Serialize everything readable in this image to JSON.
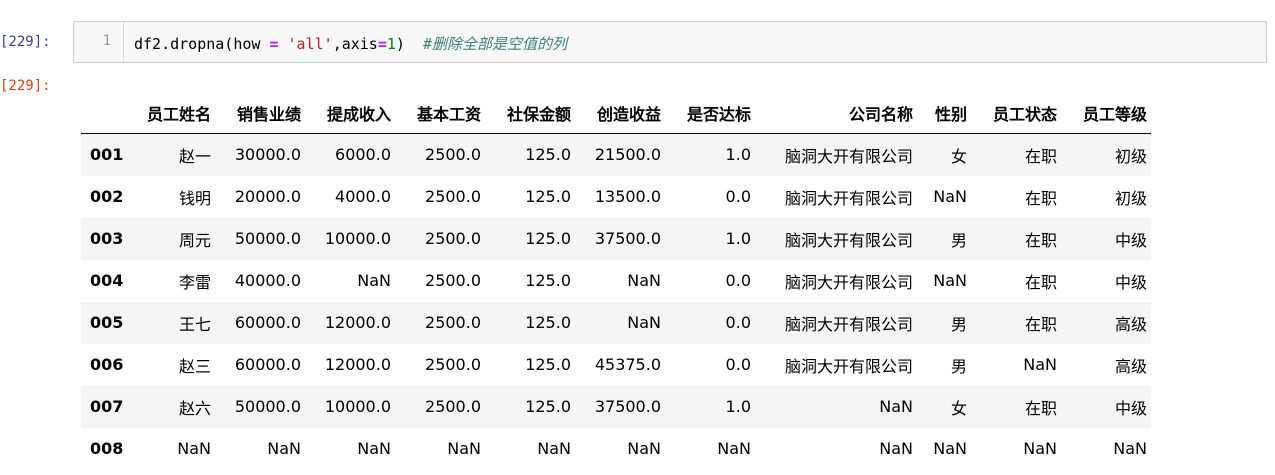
{
  "input_cell": {
    "prompt": "[229]:",
    "line_number": "1",
    "code": {
      "part1": "df2.dropna(how",
      "eq1": "=",
      "str": "'all'",
      "comma_axis": ",axis",
      "eq2": "=",
      "num": "1",
      "close": ")",
      "comment": "#删除全部是空值的列"
    }
  },
  "output_cell": {
    "prompt": "[229]:",
    "table": {
      "columns": [
        "员工姓名",
        "销售业绩",
        "提成收入",
        "基本工资",
        "社保金额",
        "创造收益",
        "是否达标",
        "公司名称",
        "性别",
        "员工状态",
        "员工等级"
      ],
      "rows": [
        {
          "index": "001",
          "cells": [
            "赵一",
            "30000.0",
            "6000.0",
            "2500.0",
            "125.0",
            "21500.0",
            "1.0",
            "脑洞大开有限公司",
            "女",
            "在职",
            "初级"
          ]
        },
        {
          "index": "002",
          "cells": [
            "钱明",
            "20000.0",
            "4000.0",
            "2500.0",
            "125.0",
            "13500.0",
            "0.0",
            "脑洞大开有限公司",
            "NaN",
            "在职",
            "初级"
          ]
        },
        {
          "index": "003",
          "cells": [
            "周元",
            "50000.0",
            "10000.0",
            "2500.0",
            "125.0",
            "37500.0",
            "1.0",
            "脑洞大开有限公司",
            "男",
            "在职",
            "中级"
          ]
        },
        {
          "index": "004",
          "cells": [
            "李雷",
            "40000.0",
            "NaN",
            "2500.0",
            "125.0",
            "NaN",
            "0.0",
            "脑洞大开有限公司",
            "NaN",
            "在职",
            "中级"
          ]
        },
        {
          "index": "005",
          "cells": [
            "王七",
            "60000.0",
            "12000.0",
            "2500.0",
            "125.0",
            "NaN",
            "0.0",
            "脑洞大开有限公司",
            "男",
            "在职",
            "高级"
          ]
        },
        {
          "index": "006",
          "cells": [
            "赵三",
            "60000.0",
            "12000.0",
            "2500.0",
            "125.0",
            "45375.0",
            "0.0",
            "脑洞大开有限公司",
            "男",
            "NaN",
            "高级"
          ]
        },
        {
          "index": "007",
          "cells": [
            "赵六",
            "50000.0",
            "10000.0",
            "2500.0",
            "125.0",
            "37500.0",
            "1.0",
            "NaN",
            "女",
            "在职",
            "中级"
          ]
        },
        {
          "index": "008",
          "cells": [
            "NaN",
            "NaN",
            "NaN",
            "NaN",
            "NaN",
            "NaN",
            "NaN",
            "NaN",
            "NaN",
            "NaN",
            "NaN"
          ]
        }
      ]
    }
  }
}
